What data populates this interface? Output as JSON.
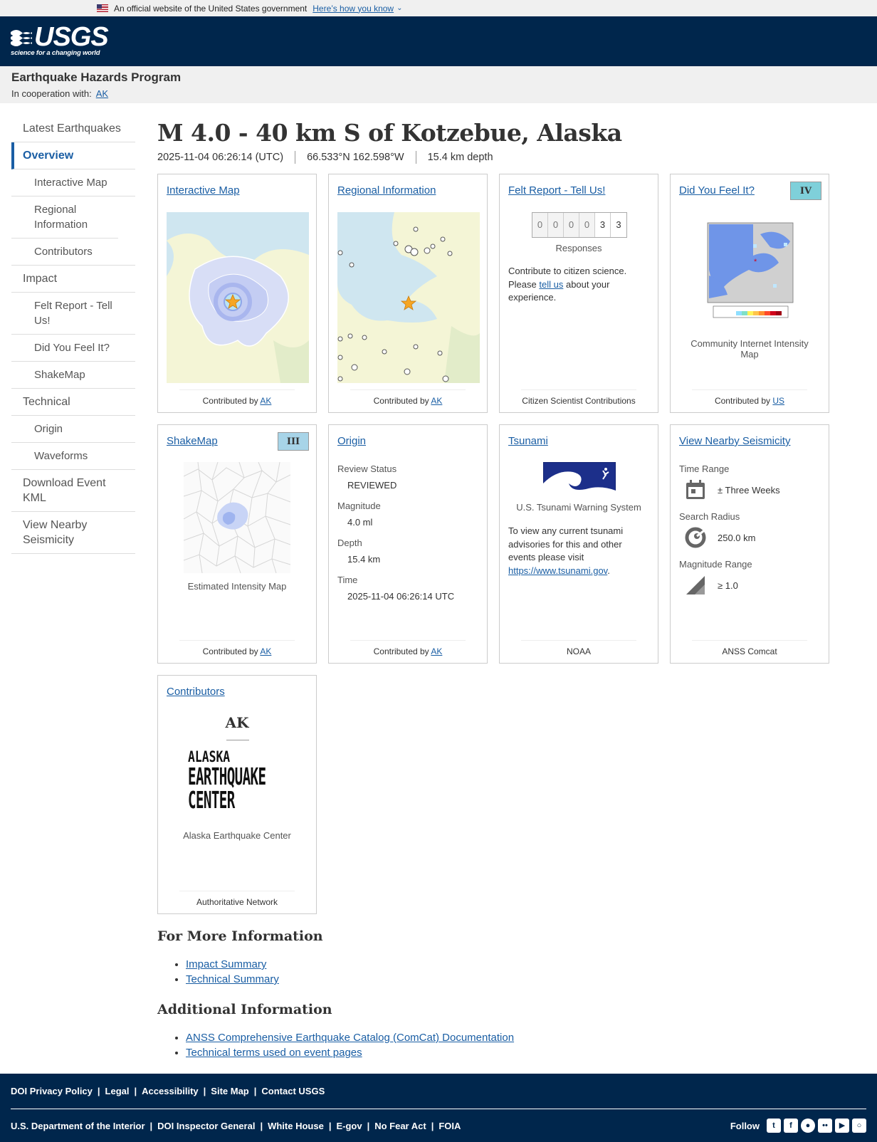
{
  "gov_banner": {
    "text": "An official website of the United States government",
    "link": "Here’s how you know"
  },
  "header": {
    "logo": "USGS",
    "tagline": "science for a changing world"
  },
  "program": {
    "title": "Earthquake Hazards Program",
    "coop_label": "In cooperation with:",
    "coop_link": "AK"
  },
  "sidebar": [
    {
      "label": "Latest Earthquakes",
      "sub": false
    },
    {
      "label": "Overview",
      "sub": false,
      "active": true
    },
    {
      "label": "Interactive Map",
      "sub": true
    },
    {
      "label": "Regional Information",
      "sub": true
    },
    {
      "label": "Contributors",
      "sub": true
    },
    {
      "label": "Impact",
      "sub": false
    },
    {
      "label": "Felt Report - Tell Us!",
      "sub": true
    },
    {
      "label": "Did You Feel It?",
      "sub": true
    },
    {
      "label": "ShakeMap",
      "sub": true
    },
    {
      "label": "Technical",
      "sub": false
    },
    {
      "label": "Origin",
      "sub": true
    },
    {
      "label": "Waveforms",
      "sub": true
    },
    {
      "label": "Download Event KML",
      "sub": false
    },
    {
      "label": "View Nearby Seismicity",
      "sub": false
    }
  ],
  "event": {
    "title": "M 4.0 - 40 km S of Kotzebue, Alaska",
    "time": "2025-11-04 06:26:14 (UTC)",
    "location": "66.533°N 162.598°W",
    "depth": "15.4 km depth"
  },
  "cards": {
    "interactive_map": {
      "title": "Interactive Map",
      "contrib_label": "Contributed by",
      "contrib": "AK"
    },
    "regional": {
      "title": "Regional Information",
      "contrib_label": "Contributed by",
      "contrib": "AK"
    },
    "felt": {
      "title": "Felt Report - Tell Us!",
      "counts": [
        "0",
        "0",
        "0",
        "0",
        "3",
        "3"
      ],
      "responses": "Responses",
      "text_a": "Contribute to citizen science. Please",
      "link": "tell us",
      "text_b": "about your experience.",
      "footer": "Citizen Scientist Contributions"
    },
    "dyfi": {
      "title": "Did You Feel It?",
      "badge": "IV",
      "badge_color": "#7fd0da",
      "caption": "Community Internet Intensity Map",
      "contrib_label": "Contributed by",
      "contrib": "US"
    },
    "shakemap": {
      "title": "ShakeMap",
      "badge": "III",
      "badge_color": "#a7d4e8",
      "caption": "Estimated Intensity Map",
      "contrib_label": "Contributed by",
      "contrib": "AK"
    },
    "origin": {
      "title": "Origin",
      "review_label": "Review Status",
      "review": "REVIEWED",
      "mag_label": "Magnitude",
      "mag": "4.0 ml",
      "depth_label": "Depth",
      "depth": "15.4 km",
      "time_label": "Time",
      "time": "2025-11-04 06:26:14 UTC",
      "contrib_label": "Contributed by",
      "contrib": "AK"
    },
    "tsunami": {
      "title": "Tsunami",
      "caption": "U.S. Tsunami Warning System",
      "text": "To view any current tsunami advisories for this and other events please visit",
      "link": "https://www.tsunami.gov",
      "footer": "NOAA"
    },
    "seismicity": {
      "title": "View Nearby Seismicity",
      "time_label": "Time Range",
      "time": "± Three Weeks",
      "radius_label": "Search Radius",
      "radius": "250.0 km",
      "mag_label": "Magnitude Range",
      "mag": "≥ 1.0",
      "footer": "ANSS Comcat"
    },
    "contributors": {
      "title": "Contributors",
      "code": "AK",
      "logo_l1": "ALASKA",
      "logo_l2": "EARTHQUAKE",
      "logo_l3": "CENTER",
      "caption": "Alaska Earthquake Center",
      "footer": "Authoritative Network"
    }
  },
  "more_info": {
    "title": "For More Information",
    "links": [
      "Impact Summary",
      "Technical Summary"
    ]
  },
  "additional": {
    "title": "Additional Information",
    "links": [
      "ANSS Comprehensive Earthquake Catalog (ComCat) Documentation",
      "Technical terms used on event pages"
    ]
  },
  "footer": {
    "row1": [
      "DOI Privacy Policy",
      "Legal",
      "Accessibility",
      "Site Map",
      "Contact USGS"
    ],
    "row2": [
      "U.S. Department of the Interior",
      "DOI Inspector General",
      "White House",
      "E-gov",
      "No Fear Act",
      "FOIA"
    ],
    "follow": "Follow",
    "social_icons": [
      "twitter-icon",
      "facebook-icon",
      "github-icon",
      "flickr-icon",
      "youtube-icon",
      "instagram-icon"
    ]
  }
}
